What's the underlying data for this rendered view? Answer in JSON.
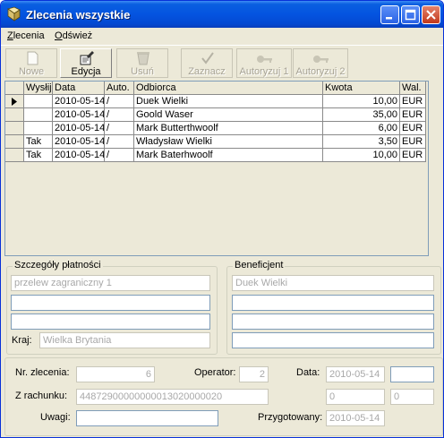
{
  "window": {
    "title": "Zlecenia wszystkie"
  },
  "menu": [
    {
      "label": "Zlecenia",
      "underline": "Z",
      "rest": "lecenia"
    },
    {
      "label": "Odśwież",
      "underline": "O",
      "rest": "dśwież"
    }
  ],
  "toolbar": [
    {
      "label": "Nowe",
      "icon": "new-document-icon",
      "enabled": false
    },
    {
      "label": "Edycja",
      "icon": "edit-icon",
      "enabled": true
    },
    {
      "label": "Usuń",
      "icon": "delete-icon",
      "enabled": false
    },
    {
      "label": "Zaznacz",
      "icon": "checkmark-icon",
      "enabled": false
    },
    {
      "label": "Autoryzuj 1",
      "icon": "authorize-key-icon",
      "enabled": false
    },
    {
      "label": "Autoryzuj 2",
      "icon": "authorize-key-icon",
      "enabled": false
    }
  ],
  "table": {
    "columns": [
      "Wysłij",
      "Data",
      "Auto.",
      "Odbiorca",
      "Kwota",
      "Wal."
    ],
    "rows": [
      {
        "send": "",
        "date": "2010-05-14",
        "auto": "/",
        "recipient": "Duek Wielki",
        "amount": "10,00",
        "currency": "EUR",
        "current": true
      },
      {
        "send": "",
        "date": "2010-05-14",
        "auto": "/",
        "recipient": "Goold Waser",
        "amount": "35,00",
        "currency": "EUR",
        "current": false
      },
      {
        "send": "",
        "date": "2010-05-14",
        "auto": "/",
        "recipient": "Mark Butterthwoolf",
        "amount": "6,00",
        "currency": "EUR",
        "current": false
      },
      {
        "send": "Tak",
        "date": "2010-05-14",
        "auto": "/",
        "recipient": "Władysław Wielki",
        "amount": "3,50",
        "currency": "EUR",
        "current": false
      },
      {
        "send": "Tak",
        "date": "2010-05-14",
        "auto": "/",
        "recipient": "Mark Baterhwoolf",
        "amount": "10,00",
        "currency": "EUR",
        "current": false
      }
    ]
  },
  "payment": {
    "title": "Szczegóły płatności",
    "line1": "przelew zagraniczny 1",
    "line2": "",
    "line3": "",
    "country_label": "Kraj:",
    "country": "Wielka Brytania"
  },
  "beneficiary": {
    "title": "Beneficjent",
    "line1": "Duek Wielki",
    "line2": "",
    "line3": "",
    "line4": ""
  },
  "details": {
    "order_no_label": "Nr. zlecenia:",
    "order_no": "6",
    "operator_label": "Operator:",
    "operator": "2",
    "date_label": "Data:",
    "date": "2010-05-14",
    "date_extra": "",
    "account_label": "Z rachunku:",
    "account": "44872900000000013020000020",
    "val1": "0",
    "val2": "0",
    "notes_label": "Uwagi:",
    "notes": "",
    "prepared_label": "Przygotowany:",
    "prepared": "2010-05-14"
  }
}
